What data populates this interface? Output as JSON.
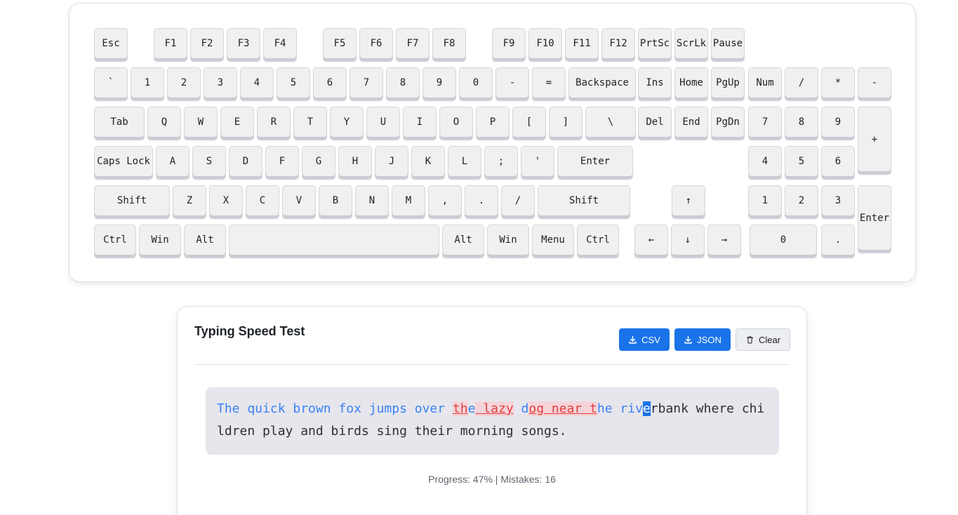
{
  "keyboard": {
    "rows": [
      [
        {
          "label": "Esc",
          "name": "key-esc"
        },
        {
          "label": "F1",
          "name": "key-f1"
        },
        {
          "label": "F2",
          "name": "key-f2"
        },
        {
          "label": "F3",
          "name": "key-f3"
        },
        {
          "label": "F4",
          "name": "key-f4"
        },
        {
          "label": "F5",
          "name": "key-f5"
        },
        {
          "label": "F6",
          "name": "key-f6"
        },
        {
          "label": "F7",
          "name": "key-f7"
        },
        {
          "label": "F8",
          "name": "key-f8"
        },
        {
          "label": "F9",
          "name": "key-f9"
        },
        {
          "label": "F10",
          "name": "key-f10"
        },
        {
          "label": "F11",
          "name": "key-f11"
        },
        {
          "label": "F12",
          "name": "key-f12"
        },
        {
          "label": "PrtSc",
          "name": "key-prtsc"
        },
        {
          "label": "ScrLk",
          "name": "key-scrlk"
        },
        {
          "label": "Pause",
          "name": "key-pause"
        }
      ],
      [
        {
          "label": "`",
          "name": "key-backtick"
        },
        {
          "label": "1",
          "name": "key-1"
        },
        {
          "label": "2",
          "name": "key-2"
        },
        {
          "label": "3",
          "name": "key-3"
        },
        {
          "label": "4",
          "name": "key-4"
        },
        {
          "label": "5",
          "name": "key-5"
        },
        {
          "label": "6",
          "name": "key-6"
        },
        {
          "label": "7",
          "name": "key-7"
        },
        {
          "label": "8",
          "name": "key-8"
        },
        {
          "label": "9",
          "name": "key-9"
        },
        {
          "label": "0",
          "name": "key-0"
        },
        {
          "label": "-",
          "name": "key-minus"
        },
        {
          "label": "=",
          "name": "key-equals"
        },
        {
          "label": "Backspace",
          "name": "key-backspace"
        },
        {
          "label": "Ins",
          "name": "key-ins"
        },
        {
          "label": "Home",
          "name": "key-home"
        },
        {
          "label": "PgUp",
          "name": "key-pgup"
        },
        {
          "label": "Num",
          "name": "key-numlock"
        },
        {
          "label": "/",
          "name": "key-num-divide"
        },
        {
          "label": "*",
          "name": "key-num-multiply"
        },
        {
          "label": "-",
          "name": "key-num-minus"
        }
      ],
      [
        {
          "label": "Tab",
          "name": "key-tab"
        },
        {
          "label": "Q",
          "name": "key-q"
        },
        {
          "label": "W",
          "name": "key-w"
        },
        {
          "label": "E",
          "name": "key-e"
        },
        {
          "label": "R",
          "name": "key-r"
        },
        {
          "label": "T",
          "name": "key-t"
        },
        {
          "label": "Y",
          "name": "key-y"
        },
        {
          "label": "U",
          "name": "key-u"
        },
        {
          "label": "I",
          "name": "key-i"
        },
        {
          "label": "O",
          "name": "key-o"
        },
        {
          "label": "P",
          "name": "key-p"
        },
        {
          "label": "[",
          "name": "key-lbracket"
        },
        {
          "label": "]",
          "name": "key-rbracket"
        },
        {
          "label": "\\",
          "name": "key-backslash"
        },
        {
          "label": "Del",
          "name": "key-del"
        },
        {
          "label": "End",
          "name": "key-end"
        },
        {
          "label": "PgDn",
          "name": "key-pgdn"
        },
        {
          "label": "7",
          "name": "key-num-7"
        },
        {
          "label": "8",
          "name": "key-num-8"
        },
        {
          "label": "9",
          "name": "key-num-9"
        },
        {
          "label": "+",
          "name": "key-num-plus"
        }
      ],
      [
        {
          "label": "Caps Lock",
          "name": "key-capslock"
        },
        {
          "label": "A",
          "name": "key-a"
        },
        {
          "label": "S",
          "name": "key-s"
        },
        {
          "label": "D",
          "name": "key-d"
        },
        {
          "label": "F",
          "name": "key-f"
        },
        {
          "label": "G",
          "name": "key-g"
        },
        {
          "label": "H",
          "name": "key-h"
        },
        {
          "label": "J",
          "name": "key-j"
        },
        {
          "label": "K",
          "name": "key-k"
        },
        {
          "label": "L",
          "name": "key-l"
        },
        {
          "label": ";",
          "name": "key-semicolon"
        },
        {
          "label": "'",
          "name": "key-quote"
        },
        {
          "label": "Enter",
          "name": "key-enter"
        },
        {
          "label": "4",
          "name": "key-num-4"
        },
        {
          "label": "5",
          "name": "key-num-5"
        },
        {
          "label": "6",
          "name": "key-num-6"
        }
      ],
      [
        {
          "label": "Shift",
          "name": "key-shift-left"
        },
        {
          "label": "Z",
          "name": "key-z"
        },
        {
          "label": "X",
          "name": "key-x"
        },
        {
          "label": "C",
          "name": "key-c"
        },
        {
          "label": "V",
          "name": "key-v"
        },
        {
          "label": "B",
          "name": "key-b"
        },
        {
          "label": "N",
          "name": "key-n"
        },
        {
          "label": "M",
          "name": "key-m"
        },
        {
          "label": ",",
          "name": "key-comma"
        },
        {
          "label": ".",
          "name": "key-period"
        },
        {
          "label": "/",
          "name": "key-slash"
        },
        {
          "label": "Shift",
          "name": "key-shift-right"
        },
        {
          "label": "↑",
          "name": "key-arrow-up"
        },
        {
          "label": "1",
          "name": "key-num-1"
        },
        {
          "label": "2",
          "name": "key-num-2"
        },
        {
          "label": "3",
          "name": "key-num-3"
        },
        {
          "label": "Enter",
          "name": "key-num-enter"
        }
      ],
      [
        {
          "label": "Ctrl",
          "name": "key-ctrl-left"
        },
        {
          "label": "Win",
          "name": "key-win-left"
        },
        {
          "label": "Alt",
          "name": "key-alt-left"
        },
        {
          "label": "",
          "name": "key-space"
        },
        {
          "label": "Alt",
          "name": "key-alt-right"
        },
        {
          "label": "Win",
          "name": "key-win-right"
        },
        {
          "label": "Menu",
          "name": "key-menu"
        },
        {
          "label": "Ctrl",
          "name": "key-ctrl-right"
        },
        {
          "label": "←",
          "name": "key-arrow-left"
        },
        {
          "label": "↓",
          "name": "key-arrow-down"
        },
        {
          "label": "→",
          "name": "key-arrow-right"
        },
        {
          "label": "0",
          "name": "key-num-0"
        },
        {
          "label": ".",
          "name": "key-num-decimal"
        }
      ]
    ]
  },
  "typing_test": {
    "title": "Typing Speed Test",
    "buttons": {
      "csv": {
        "label": "CSV",
        "icon": "download-icon"
      },
      "json": {
        "label": "JSON",
        "icon": "download-icon"
      },
      "clear": {
        "label": "Clear",
        "icon": "trash-icon"
      }
    },
    "text_segments": [
      {
        "text": "The quick brown fox jumps over ",
        "state": "correct"
      },
      {
        "text": "th",
        "state": "error"
      },
      {
        "text": "e",
        "state": "correct"
      },
      {
        "text": " lazy",
        "state": "error"
      },
      {
        "text": " ",
        "state": "correct"
      },
      {
        "text": "d",
        "state": "correct"
      },
      {
        "text": "og near t",
        "state": "error"
      },
      {
        "text": "he riv",
        "state": "correct"
      },
      {
        "text": "e",
        "state": "cursor"
      },
      {
        "text": "rbank where chi",
        "state": "pending"
      }
    ],
    "text_line_2": "ldren play and birds sing their morning songs.",
    "progress_percent": 47,
    "mistakes": 16,
    "status_text": "Progress: 47% | Mistakes: 16"
  },
  "colors": {
    "accent": "#1a73e8",
    "correct": "#3b82f6",
    "error": "#e53e3e",
    "error_bg": "#f4d4d8",
    "text_bg": "#e6e6ec"
  }
}
